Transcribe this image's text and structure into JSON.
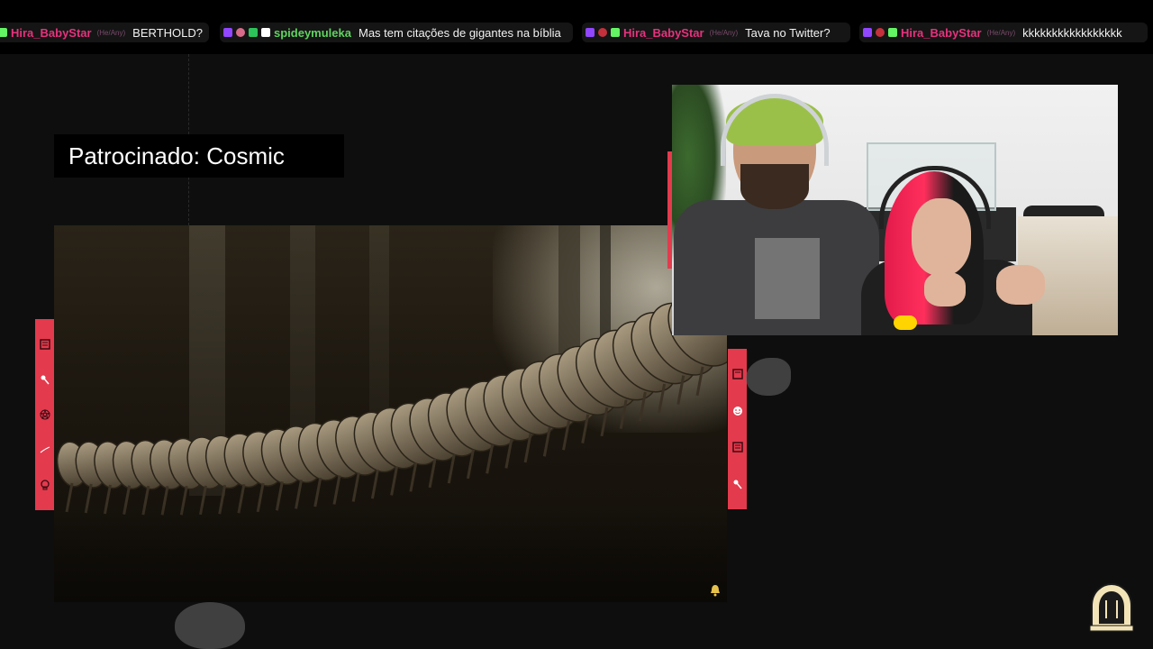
{
  "chat": {
    "messages": [
      {
        "user": "Hira_BabyStar",
        "pronoun": "(He/Any)",
        "text": "BERTHOLD?",
        "user_color": "#e6327d"
      },
      {
        "user": "spideymuleka",
        "pronoun": "",
        "text": "Mas tem citações de gigantes na bíblia",
        "user_color": "#5fd35f"
      },
      {
        "user": "Hira_BabyStar",
        "pronoun": "(He/Any)",
        "text": "Tava no Twitter?",
        "user_color": "#e6327d"
      },
      {
        "user": "Hira_BabyStar",
        "pronoun": "(He/Any)",
        "text": "kkkkkkkkkkkkkkkkk",
        "user_color": "#e6327d"
      }
    ]
  },
  "overlay": {
    "sponsor_label": "Patrocinado: Cosmic",
    "accent_color": "#e33a4d"
  },
  "icons": {
    "strip_left": [
      "frame-icon",
      "spoon-icon",
      "pentagram-icon",
      "curve-icon",
      "skull-icon"
    ],
    "strip_right": [
      "frame-icon",
      "smiley-icon",
      "frame-icon",
      "spoon-icon"
    ],
    "channel_logo": "alien-logo-icon",
    "video_bell": "bell-icon"
  }
}
